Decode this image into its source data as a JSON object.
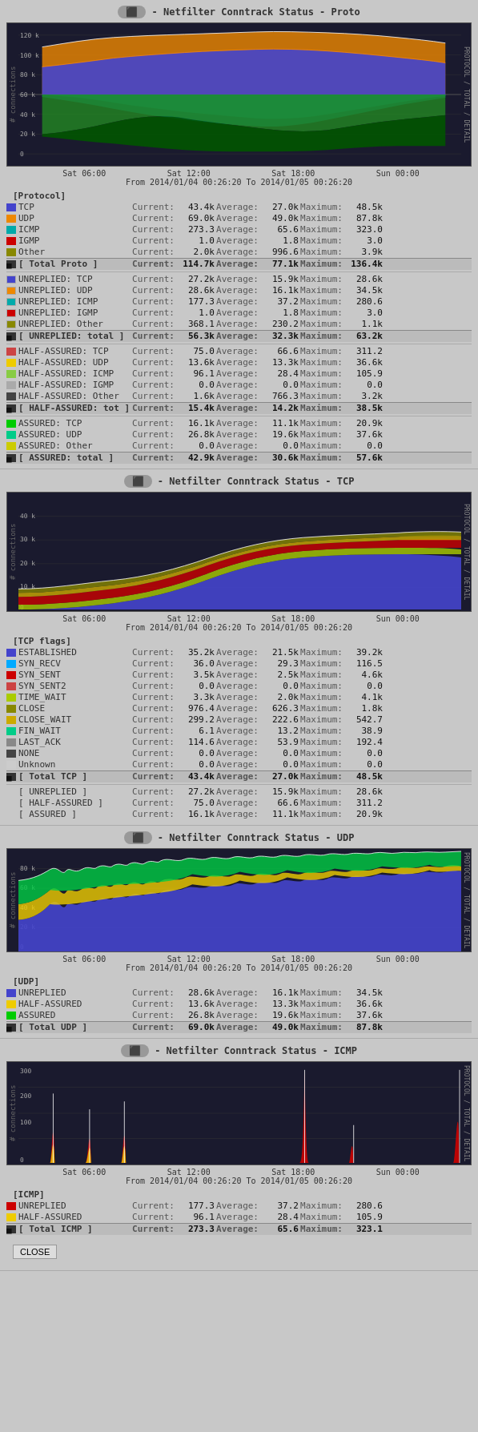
{
  "charts": [
    {
      "id": "proto",
      "title": "- Netfilter Conntrack Status - Proto",
      "timerange": "From 2014/01/04 00:26:20 To 2014/01/05 00:26:20",
      "xlabels": [
        "Sat 06:00",
        "Sat 12:00",
        "Sat 18:00",
        "Sun 00:00"
      ],
      "ylabel": "# connections",
      "rightlabel": "PROTOCOL / TOTAL / DETAIL",
      "height": 170,
      "ymax": "120 k",
      "ymid": "0",
      "ymin": "-120 k"
    },
    {
      "id": "tcp",
      "title": "- Netfilter Conntrack Status - TCP",
      "timerange": "From 2014/01/04 00:26:20 To 2014/01/05 00:26:20",
      "xlabels": [
        "Sat 06:00",
        "Sat 12:00",
        "Sat 18:00",
        "Sun 00:00"
      ],
      "ylabel": "# connections",
      "rightlabel": "PROTOCOL / TOTAL / DETAIL",
      "height": 130,
      "ymax": "40 k",
      "ymid": "",
      "ymin": "0"
    },
    {
      "id": "udp",
      "title": "- Netfilter Conntrack Status - UDP",
      "timerange": "From 2014/01/04 00:26:20 To 2014/01/05 00:26:20",
      "xlabels": [
        "Sat 06:00",
        "Sat 12:00",
        "Sat 18:00",
        "Sun 00:00"
      ],
      "ylabel": "# connections",
      "rightlabel": "PROTOCOL / TOTAL / DETAIL",
      "height": 110,
      "ymax": "80 k",
      "ymid": "",
      "ymin": "0"
    },
    {
      "id": "icmp",
      "title": "- Netfilter Conntrack Status - ICMP",
      "timerange": "From 2014/01/04 00:26:20 To 2014/01/05 00:26:20",
      "xlabels": [
        "Sat 06:00",
        "Sat 12:00",
        "Sat 18:00",
        "Sun 00:00"
      ],
      "ylabel": "# connections",
      "rightlabel": "PROTOCOL / TOTAL / DETAIL",
      "height": 110,
      "ymax": "300",
      "ymid": "",
      "ymin": "0"
    }
  ],
  "proto_stats": {
    "group_label": "[Protocol]",
    "items": [
      {
        "color": "#4444cc",
        "label": "TCP",
        "current": "43.4k",
        "average": "27.0k",
        "maximum": "48.5k"
      },
      {
        "color": "#ee8800",
        "label": "UDP",
        "current": "69.0k",
        "average": "49.0k",
        "maximum": "87.8k"
      },
      {
        "color": "#00aaaa",
        "label": "ICMP",
        "current": "273.3",
        "average": "65.6",
        "maximum": "323.0"
      },
      {
        "color": "#cc0000",
        "label": "IGMP",
        "current": "1.0",
        "average": "1.8",
        "maximum": "3.0"
      },
      {
        "color": "#888800",
        "label": "Other",
        "current": "2.0k",
        "average": "996.6",
        "maximum": "3.9k"
      }
    ],
    "total": {
      "label": "[ Total Proto ]",
      "current": "114.7k",
      "average": "77.1k",
      "maximum": "136.4k"
    }
  },
  "unreplied_stats": {
    "items": [
      {
        "color": "#4444cc",
        "label": "UNREPLIED: TCP",
        "current": "27.2k",
        "average": "15.9k",
        "maximum": "28.6k"
      },
      {
        "color": "#ee8800",
        "label": "UNREPLIED: UDP",
        "current": "28.6k",
        "average": "16.1k",
        "maximum": "34.5k"
      },
      {
        "color": "#00aaaa",
        "label": "UNREPLIED: ICMP",
        "current": "177.3",
        "average": "37.2",
        "maximum": "280.6"
      },
      {
        "color": "#cc0000",
        "label": "UNREPLIED: IGMP",
        "current": "1.0",
        "average": "1.8",
        "maximum": "3.0"
      },
      {
        "color": "#888800",
        "label": "UNREPLIED: Other",
        "current": "368.1",
        "average": "230.2",
        "maximum": "1.1k"
      }
    ],
    "total": {
      "label": "[ UNREPLIED: total ]",
      "current": "56.3k",
      "average": "32.3k",
      "maximum": "63.2k"
    }
  },
  "half_assured_stats": {
    "items": [
      {
        "color": "#cc4444",
        "label": "HALF-ASSURED: TCP",
        "current": "75.0",
        "average": "66.6",
        "maximum": "311.2"
      },
      {
        "color": "#eecc00",
        "label": "HALF-ASSURED: UDP",
        "current": "13.6k",
        "average": "13.3k",
        "maximum": "36.6k"
      },
      {
        "color": "#88cc44",
        "label": "HALF-ASSURED: ICMP",
        "current": "96.1",
        "average": "28.4",
        "maximum": "105.9"
      },
      {
        "color": "#aaaaaa",
        "label": "HALF-ASSURED: IGMP",
        "current": "0.0",
        "average": "0.0",
        "maximum": "0.0"
      },
      {
        "color": "#444444",
        "label": "HALF-ASSURED: Other",
        "current": "1.6k",
        "average": "766.3",
        "maximum": "3.2k"
      }
    ],
    "total": {
      "label": "[ HALF-ASSURED: tot ]",
      "current": "15.4k",
      "average": "14.2k",
      "maximum": "38.5k"
    }
  },
  "assured_stats": {
    "items": [
      {
        "color": "#00cc00",
        "label": "ASSURED: TCP",
        "current": "16.1k",
        "average": "11.1k",
        "maximum": "20.9k"
      },
      {
        "color": "#00cc88",
        "label": "ASSURED: UDP",
        "current": "26.8k",
        "average": "19.6k",
        "maximum": "37.6k"
      },
      {
        "color": "#cccc00",
        "label": "ASSURED: Other",
        "current": "0.0",
        "average": "0.0",
        "maximum": "0.0"
      }
    ],
    "total": {
      "label": "[ ASSURED: total ]",
      "current": "42.9k",
      "average": "30.6k",
      "maximum": "57.6k"
    }
  },
  "tcp_stats": {
    "group_label": "[TCP flags]",
    "items": [
      {
        "color": "#4444cc",
        "label": "ESTABLISHED",
        "current": "35.2k",
        "average": "21.5k",
        "maximum": "39.2k"
      },
      {
        "color": "#00aaff",
        "label": "SYN_RECV",
        "current": "36.0",
        "average": "29.3",
        "maximum": "116.5"
      },
      {
        "color": "#cc0000",
        "label": "SYN_SENT",
        "current": "3.5k",
        "average": "2.5k",
        "maximum": "4.6k"
      },
      {
        "color": "#cc4444",
        "label": "SYN_SENT2",
        "current": "0.0",
        "average": "0.0",
        "maximum": "0.0"
      },
      {
        "color": "#aacc00",
        "label": "TIME_WAIT",
        "current": "3.3k",
        "average": "2.0k",
        "maximum": "4.1k"
      },
      {
        "color": "#888800",
        "label": "CLOSE",
        "current": "976.4",
        "average": "626.3",
        "maximum": "1.8k"
      },
      {
        "color": "#ccaa00",
        "label": "CLOSE_WAIT",
        "current": "299.2",
        "average": "222.6",
        "maximum": "542.7"
      },
      {
        "color": "#00cc88",
        "label": "FIN_WAIT",
        "current": "6.1",
        "average": "13.2",
        "maximum": "38.9"
      },
      {
        "color": "#888888",
        "label": "LAST_ACK",
        "current": "114.6",
        "average": "53.9",
        "maximum": "192.4"
      },
      {
        "color": "#444444",
        "label": "NONE",
        "current": "0.0",
        "average": "0.0",
        "maximum": "0.0"
      },
      {
        "color": "#cccccc",
        "label": "Unknown",
        "current": "0.0",
        "average": "0.0",
        "maximum": "0.0"
      }
    ],
    "total": {
      "label": "[ Total TCP ]",
      "current": "43.4k",
      "average": "27.0k",
      "maximum": "48.5k"
    },
    "subtotals": [
      {
        "label": "[ UNREPLIED   ]",
        "current": "27.2k",
        "average": "15.9k",
        "maximum": "28.6k"
      },
      {
        "label": "[ HALF-ASSURED ]",
        "current": "75.0",
        "average": "66.6",
        "maximum": "311.2"
      },
      {
        "label": "[ ASSURED     ]",
        "current": "16.1k",
        "average": "11.1k",
        "maximum": "20.9k"
      }
    ]
  },
  "udp_stats": {
    "group_label": "[UDP]",
    "items": [
      {
        "color": "#4444cc",
        "label": "UNREPLIED",
        "current": "28.6k",
        "average": "16.1k",
        "maximum": "34.5k"
      },
      {
        "color": "#eecc00",
        "label": "HALF-ASSURED",
        "current": "13.6k",
        "average": "13.3k",
        "maximum": "36.6k"
      },
      {
        "color": "#00cc00",
        "label": "ASSURED",
        "current": "26.8k",
        "average": "19.6k",
        "maximum": "37.6k"
      }
    ],
    "total": {
      "label": "[ Total UDP ]",
      "current": "69.0k",
      "average": "49.0k",
      "maximum": "87.8k"
    }
  },
  "icmp_stats": {
    "group_label": "[ICMP]",
    "items": [
      {
        "color": "#cc0000",
        "label": "UNREPLIED",
        "current": "177.3",
        "average": "37.2",
        "maximum": "280.6"
      },
      {
        "color": "#eecc00",
        "label": "HALF-ASSURED",
        "current": "96.1",
        "average": "28.4",
        "maximum": "105.9"
      }
    ],
    "total": {
      "label": "[ Total ICMP ]",
      "current": "273.3",
      "average": "65.6",
      "maximum": "323.1"
    }
  },
  "labels": {
    "current": "Current:",
    "average": "Average:",
    "maximum": "Maximum:",
    "timerange_prefix": "From 2014/01/04 00:26:20 To 2014/01/05 00:26:20",
    "close_btn": "CLOSE"
  }
}
